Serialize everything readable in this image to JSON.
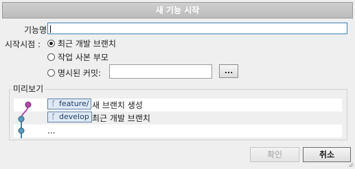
{
  "window": {
    "title": "새 기능 시작"
  },
  "feature_name": {
    "label": "기능명",
    "value": ""
  },
  "start_point": {
    "label": "시작시점 :",
    "options": [
      {
        "label": "최근 개발 브랜치",
        "checked": true
      },
      {
        "label": "작업 사본 부모",
        "checked": false
      },
      {
        "label": "명시된 커밋:",
        "checked": false
      }
    ],
    "commit_value": "",
    "browse_label": "..."
  },
  "preview": {
    "label": "미리보기",
    "rows": [
      {
        "tag": "feature/",
        "text": "새 브랜치 생성"
      },
      {
        "tag": "develop",
        "text": "최근 개발 브랜치"
      },
      {
        "tag": "",
        "text": "..."
      }
    ],
    "colors": {
      "feature_line": "#b04aa8",
      "develop_line": "#3b86a8"
    }
  },
  "buttons": {
    "ok": "확인",
    "cancel": "취소"
  }
}
